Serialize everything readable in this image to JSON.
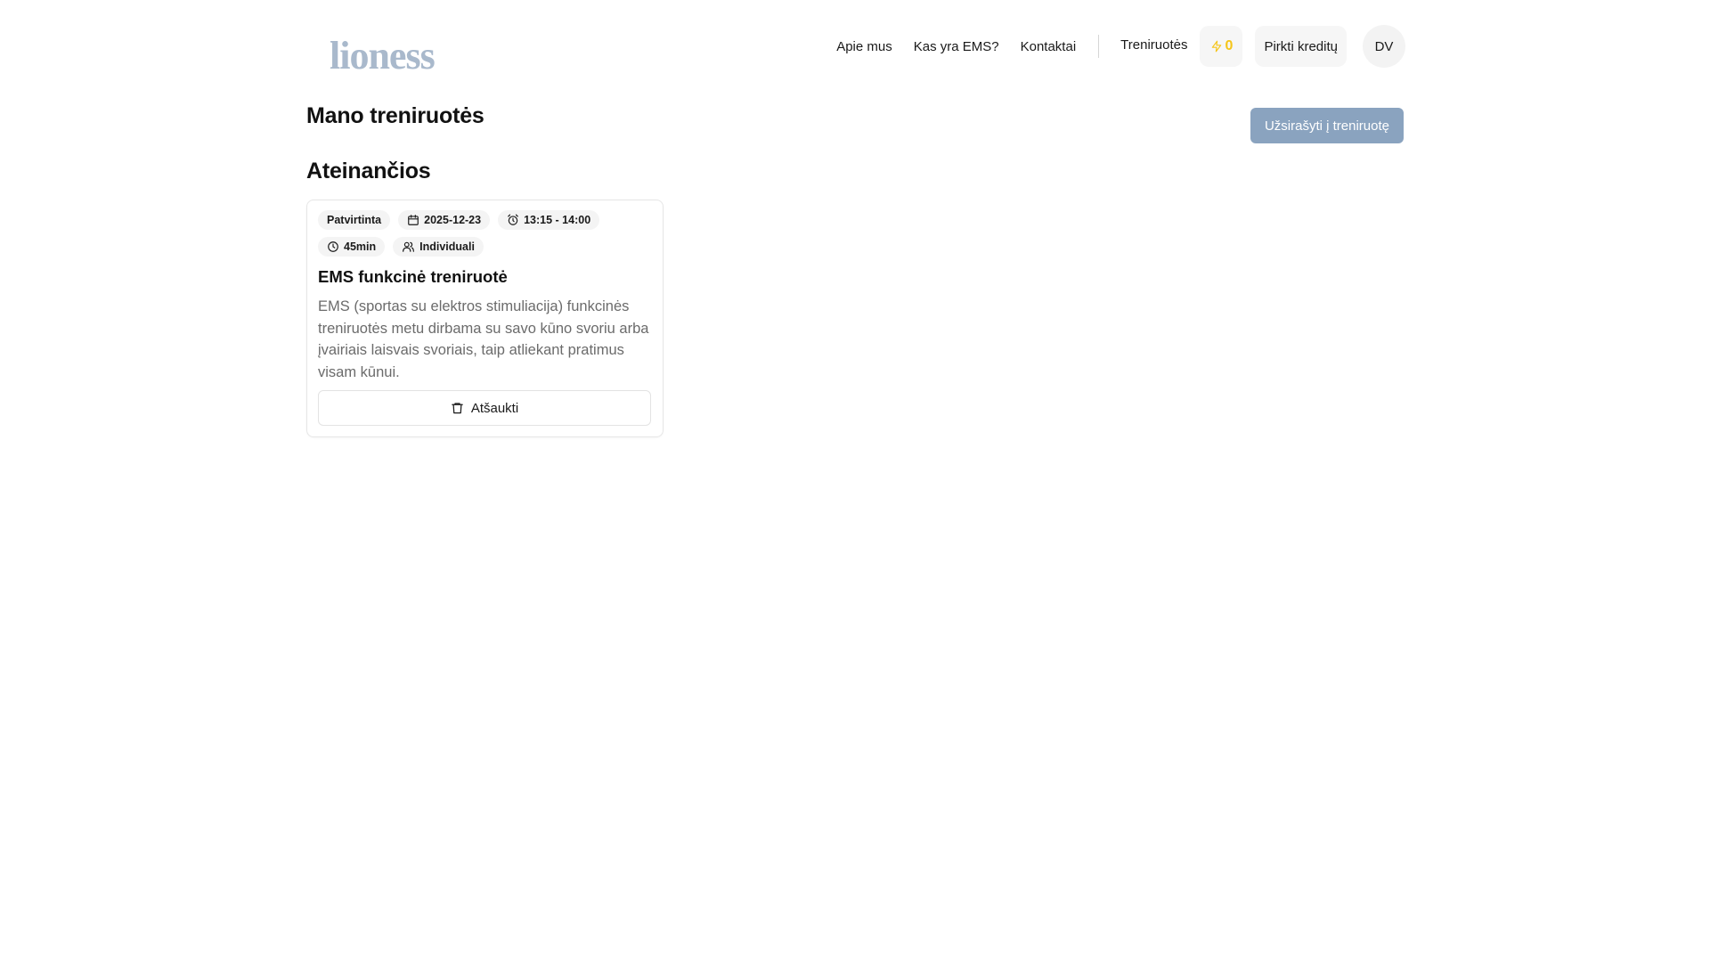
{
  "brand": {
    "logo_text": "lioness"
  },
  "nav": {
    "items": [
      {
        "label": "Apie mus"
      },
      {
        "label": "Kas yra EMS?"
      },
      {
        "label": "Kontaktai"
      }
    ],
    "trainings_label": "Treniruotės",
    "credits_count": "0",
    "buy_credits_label": "Pirkti kreditų",
    "avatar_initials": "DV"
  },
  "page": {
    "title": "Mano treniruotės",
    "book_button_label": "Užsirašyti į treniruotę",
    "upcoming_title": "Ateinančios"
  },
  "training_card": {
    "status": "Patvirtinta",
    "date": "2025-12-23",
    "time": "13:15 - 14:00",
    "duration": "45min",
    "type": "Individuali",
    "title": "EMS funkcinė treniruotė",
    "description": "EMS (sportas su elektros stimuliacija) funkcinės treniruotės metu dirbama su savo kūno svoriu arba įvairiais laisvais svoriais, taip atliekant pratimus visam kūnui.",
    "cancel_label": "Atšaukti"
  },
  "icons": {
    "credits": "lightning-icon",
    "date": "calendar-icon",
    "time": "alarm-clock-icon",
    "duration": "clock-icon",
    "type": "users-icon",
    "cancel": "trash-icon"
  },
  "colors": {
    "accent_button": "#8aa3bf",
    "credits": "#f5c518",
    "logo": "#a9b9cc"
  }
}
